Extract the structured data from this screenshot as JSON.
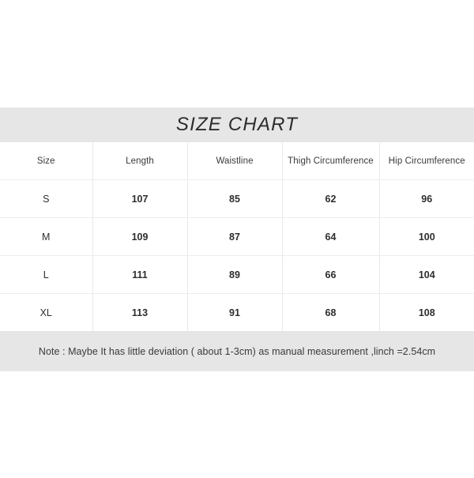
{
  "chart_data": {
    "type": "table",
    "title": "SIZE CHART",
    "columns": [
      "Size",
      "Length",
      "Waistline",
      "Thigh Circumference",
      "Hip Circumference"
    ],
    "rows": [
      [
        "S",
        "107",
        "85",
        "62",
        "96"
      ],
      [
        "M",
        "109",
        "87",
        "64",
        "100"
      ],
      [
        "L",
        "111",
        "89",
        "66",
        "104"
      ],
      [
        "XL",
        "113",
        "91",
        "68",
        "108"
      ]
    ],
    "note": "Note : Maybe It has little deviation ( about 1-3cm) as manual measurement ,linch =2.54cm",
    "units": "cm"
  },
  "title": {
    "text": "SIZE CHART"
  },
  "table": {
    "headers": [
      {
        "label": "Size"
      },
      {
        "label": "Length"
      },
      {
        "label": "Waistline"
      },
      {
        "label": "Thigh Circumference"
      },
      {
        "label": "Hip Circumference"
      }
    ],
    "rows": [
      {
        "size": "S",
        "length": "107",
        "waistline": "85",
        "thigh": "62",
        "hip": "96"
      },
      {
        "size": "M",
        "length": "109",
        "waistline": "87",
        "thigh": "64",
        "hip": "100"
      },
      {
        "size": "L",
        "length": "111",
        "waistline": "89",
        "thigh": "66",
        "hip": "104"
      },
      {
        "size": "XL",
        "length": "113",
        "waistline": "91",
        "thigh": "68",
        "hip": "108"
      }
    ]
  },
  "note": {
    "text": "Note : Maybe It has little deviation ( about 1-3cm) as manual measurement ,linch =2.54cm"
  },
  "colors": {
    "band_gray": "#e6e6e6",
    "background": "#ffffff",
    "text_dark": "#2e2e2e",
    "grid_line": "#ededed"
  }
}
